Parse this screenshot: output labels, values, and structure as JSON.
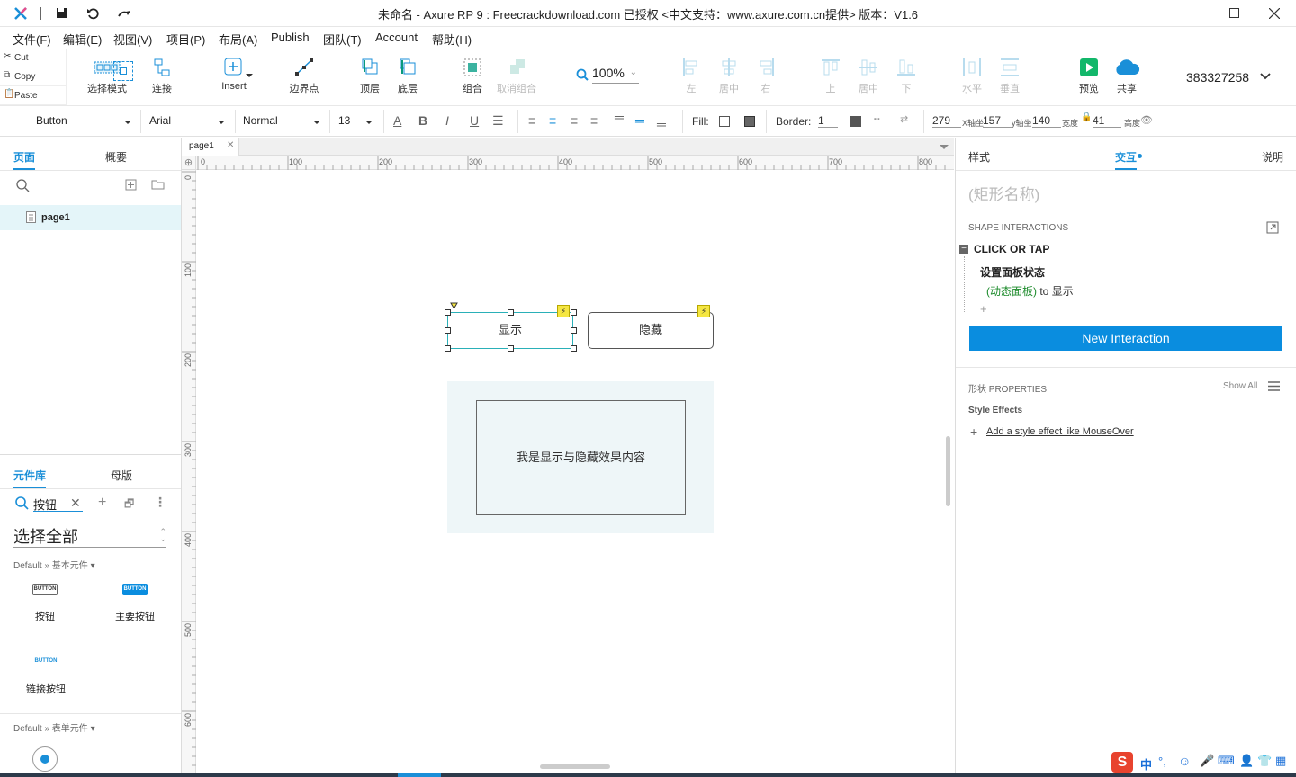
{
  "title_bar": {
    "title": "未命名 - Axure RP 9 : Freecrackdownload.com 已授权   <中文支持：www.axure.com.cn提供> 版本：V1.6"
  },
  "menu": [
    "文件(F)",
    "编辑(E)",
    "视图(V)",
    "项目(P)",
    "布局(A)",
    "Publish",
    "团队(T)",
    "Account",
    "帮助(H)"
  ],
  "clipboard": {
    "cut": "Cut",
    "copy": "Copy",
    "paste": "Paste"
  },
  "toolbar": {
    "select_mode": "选择模式",
    "connect": "连接",
    "insert": "Insert",
    "boundary": "边界点",
    "top": "顶层",
    "bottom": "底层",
    "group": "组合",
    "ungroup": "取消组合",
    "zoom": "100%",
    "left": "左",
    "center": "居中",
    "right": "右",
    "up": "上",
    "middle": "居中",
    "down": "下",
    "horizontal": "水平",
    "vertical": "垂直",
    "preview": "预览",
    "share": "共享",
    "account_id": "383327258"
  },
  "format_bar": {
    "widget_type": "Button",
    "font": "Arial",
    "weight": "Normal",
    "size": "13",
    "fill_label": "Fill:",
    "border_label": "Border:",
    "border_value": "1",
    "x": "279",
    "x_label": "X轴坐",
    "y": "157",
    "y_label": "y轴坐",
    "w": "140",
    "w_label": "宽度",
    "h": "41",
    "h_label": "高度"
  },
  "left_panel": {
    "tab_pages": "页面",
    "tab_outline": "概要",
    "page_name": "page1",
    "tab_library": "元件库",
    "tab_masters": "母版",
    "search_value": "按钮",
    "select_all": "选择全部",
    "section1": "Default » 基本元件 ▾",
    "section2": "Default » 表单元件 ▾",
    "widgets": [
      {
        "label": "按钮",
        "thumb": "BUTTON"
      },
      {
        "label": "主要按钮",
        "thumb": "BUTTON"
      },
      {
        "label": "链接按钮",
        "thumb": "BUTTON"
      }
    ]
  },
  "canvas": {
    "tab": "page1",
    "ruler_h": [
      "0",
      "100",
      "200",
      "300",
      "400",
      "500",
      "600",
      "700",
      "800"
    ],
    "ruler_v": [
      "0",
      "100",
      "200",
      "300",
      "400",
      "500",
      "600"
    ],
    "btn_show": "显示",
    "btn_hide": "隐藏",
    "panel_text": "我是显示与隐藏效果内容"
  },
  "right_panel": {
    "tab_style": "样式",
    "tab_interact": "交互",
    "tab_notes": "说明",
    "name_placeholder": "(矩形名称)",
    "section_interactions": "SHAPE INTERACTIONS",
    "event": "CLICK OR TAP",
    "action": "设置面板状态",
    "target": "(动态面板)",
    "to_word": "to",
    "state": "显示",
    "new_interaction": "New Interaction",
    "properties": "形状 PROPERTIES",
    "show_all": "Show All",
    "style_effects": "Style Effects",
    "add_effect": "Add a style effect like MouseOver"
  },
  "colors": {
    "accent": "#1a8fd8",
    "button_blue": "#0a8ddf",
    "canvas_panel": "#eef6f8",
    "selection": "#2ab0b8"
  }
}
